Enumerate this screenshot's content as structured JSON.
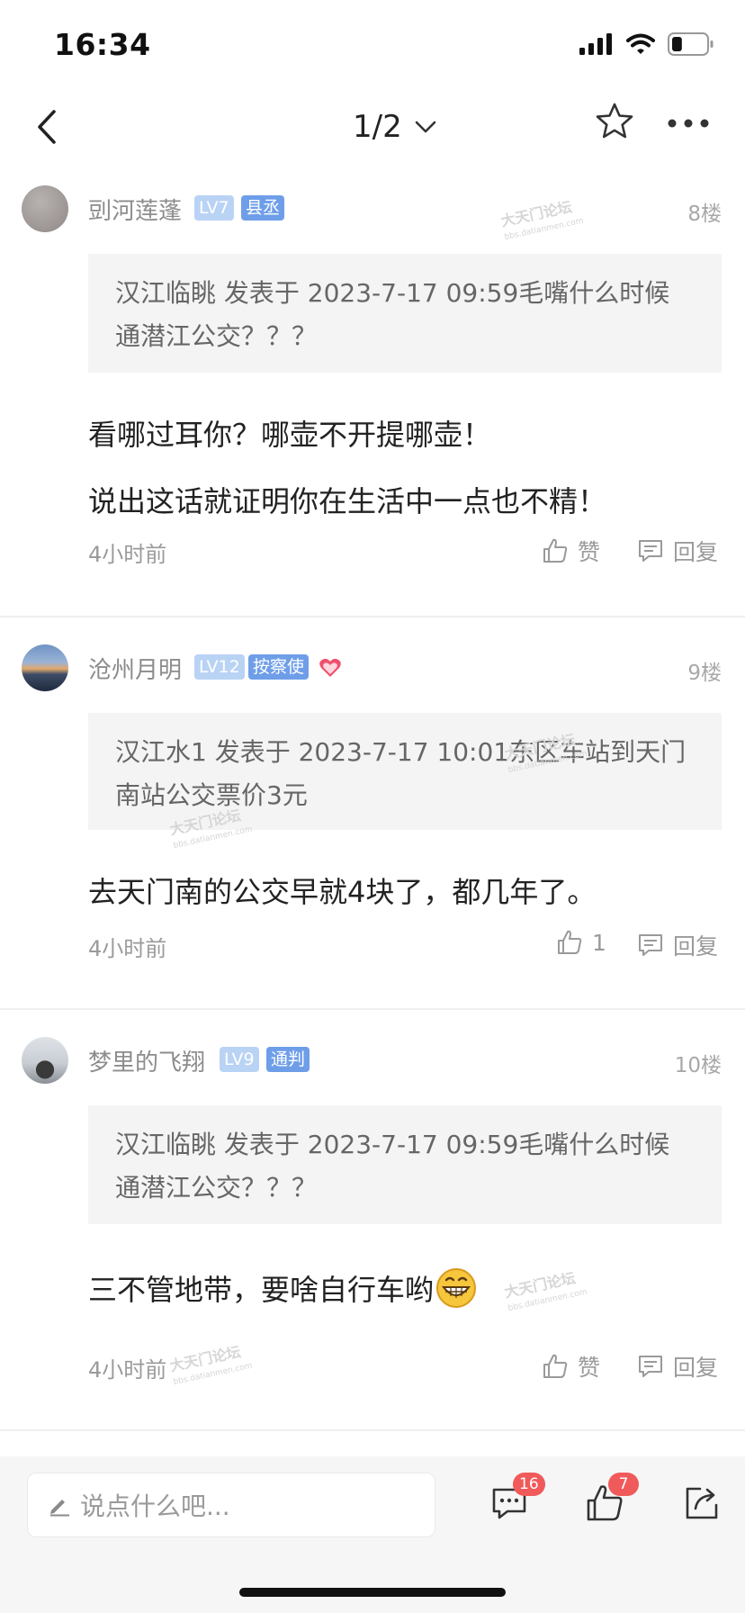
{
  "status_bar": {
    "time": "16:34",
    "battery_level": 0.3
  },
  "nav": {
    "page_indicator": "1/2"
  },
  "posts": [
    {
      "username": "剅河莲蓬",
      "level": "LV7",
      "title_badge": "县丞",
      "floor": "8楼",
      "quote": "汉江临眺 发表于 2023-7-17 09:59毛嘴什么时候通潜江公交？？？",
      "content": [
        "看哪过耳你？哪壶不开提哪壶！",
        "说出这话就证明你在生活中一点也不精！"
      ],
      "time_ago": "4小时前",
      "like_label": "赞",
      "reply_label": "回复"
    },
    {
      "username": "沧州月明",
      "level": "LV12",
      "title_badge": "按察使",
      "floor": "9楼",
      "quote": "汉江水1 发表于 2023-7-17 10:01东区车站到天门南站公交票价3元",
      "content": [
        "去天门南的公交早就4块了，都几年了。"
      ],
      "time_ago": "4小时前",
      "like_label": "1",
      "reply_label": "回复"
    },
    {
      "username": "梦里的飞翔",
      "level": "LV9",
      "title_badge": "通判",
      "floor": "10楼",
      "quote": "汉江临眺 发表于 2023-7-17 09:59毛嘴什么时候通潜江公交？？？",
      "content": [
        "三不管地带，要啥自行车哟"
      ],
      "time_ago": "4小时前",
      "like_label": "赞",
      "reply_label": "回复"
    }
  ],
  "watermark": {
    "title": "大天门论坛",
    "url": "bbs.datianmen.com"
  },
  "bottom_bar": {
    "input_placeholder": "说点什么吧...",
    "comment_count": "16",
    "like_count": "7"
  },
  "colors": {
    "badge_level": "#b9d3f5",
    "badge_title": "#6f9ee9",
    "count_badge": "#f05a5a",
    "heart": "#f0506e"
  }
}
